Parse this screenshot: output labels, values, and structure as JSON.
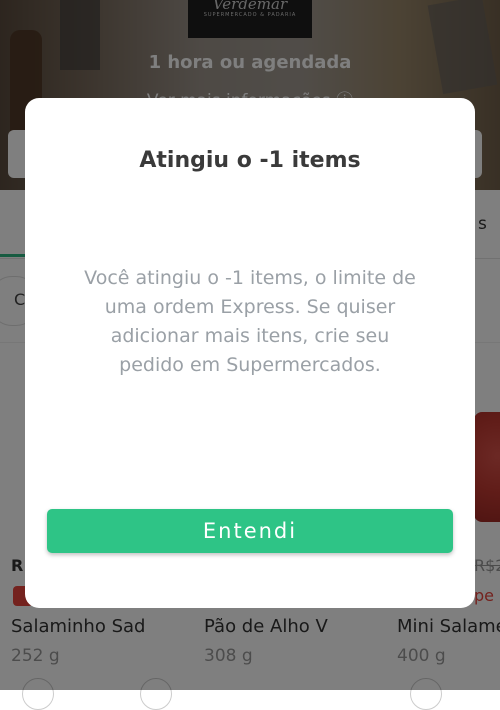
{
  "store": {
    "logo_name": "Verdemar",
    "logo_sub": "SUPERMERCADO & PADARIA",
    "delivery_time": "1 hora  ou agendada",
    "more_info": "Ver mais informações ⓘ"
  },
  "tabs": {
    "right_partial": "s"
  },
  "filters": {
    "chip_partial": "C"
  },
  "products": [
    {
      "price_partial": "R",
      "name": "Salaminho Sad",
      "weight": "252 g"
    },
    {
      "name": "Pão de Alho V",
      "weight": "308 g"
    },
    {
      "price_partial": "R$2",
      "tag_partial": "pe",
      "name": "Mini Salame",
      "weight": "400 g"
    }
  ],
  "modal": {
    "title": "Atingiu o -1 items",
    "message": "Você atingiu o -1 items, o limite de uma ordem Express. Se quiser adicionar mais itens, crie seu pedido em Supermercados.",
    "button_label": "Entendi"
  },
  "colors": {
    "accent": "#2ec486",
    "overlay": "rgba(0,0,0,0.5)",
    "sale_red": "#e8453c"
  }
}
